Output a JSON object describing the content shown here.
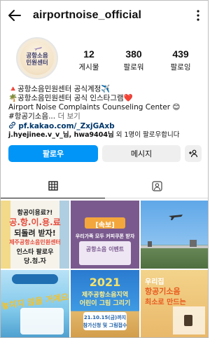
{
  "header": {
    "username": "airportnoise_official"
  },
  "icons": {
    "back": "back-arrow-icon",
    "menu": "vertical-ellipsis-icon",
    "add_person": "add-person-icon",
    "grid": "grid-icon",
    "tagged": "tagged-person-icon"
  },
  "profile": {
    "avatar_text_1": "공항소음",
    "avatar_text_2": "민원센터",
    "stats": [
      {
        "value": "12",
        "label": "게시물"
      },
      {
        "value": "380",
        "label": "팔로워"
      },
      {
        "value": "439",
        "label": "팔로잉"
      }
    ]
  },
  "bio": {
    "line1": "🔺공항소음민원센터 공식계정✈️",
    "line2": "🌴공항소음민원센터 공식 인스타그램❤️",
    "line3": "Airport Noise Complaints Counseling Center 😊",
    "line4_tags": "#항공기소음...",
    "line4_more": " 더 보기",
    "link": "pf.kakao.com/_ZxjGAxb",
    "mutual_users": "j.hyejinee.v_v_님, hwa9404님",
    "mutual_suffix": " 외 1명이 팔로우합니다"
  },
  "buttons": {
    "follow": "팔로우",
    "message": "메시지"
  },
  "colors": {
    "follow_button": "#0095f6",
    "link": "#00376b",
    "secondary_button": "#efefef"
  },
  "posts": {
    "p1_line1": "항공이용료?!",
    "p1_line2": "공.항.이.용.료",
    "p1_line3": "되돌려 받자!",
    "p1_line4": "제주공항소음민원센터",
    "p1_line5": "인스타 팔로우",
    "p1_line6": "당.첨.자",
    "p2_badge": "[속보]",
    "p2_line1": "우리가족 모두 커피쿠폰 받자",
    "p2_line2": "공항소음 이벤트",
    "p4_line1": "놓치지 않을 거예요",
    "p5_line1": "2021",
    "p5_line2": "제주공항소음지역",
    "p5_line3": "어린이 그림 그리기",
    "p5_line4": "21.10.15(금)까지",
    "p5_line5": "참가신청 및 그림접수",
    "p6_line1": "우리집",
    "p6_line2": "항공기소음",
    "p6_line3": "최소로 만드는"
  }
}
